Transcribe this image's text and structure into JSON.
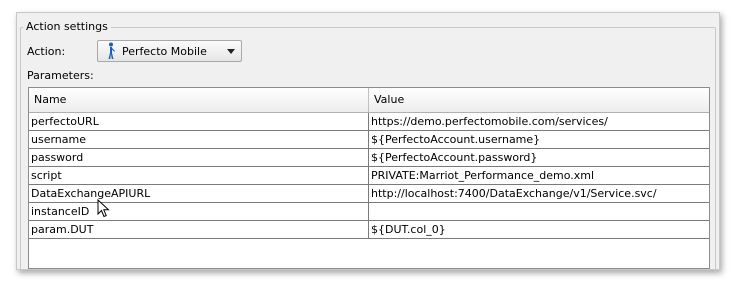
{
  "group_title": "Action settings",
  "action": {
    "label": "Action:",
    "selected": "Perfecto Mobile"
  },
  "parameters_label": "Parameters:",
  "table": {
    "columns": [
      "Name",
      "Value"
    ],
    "rows": [
      {
        "name": "perfectoURL",
        "value": "https://demo.perfectomobile.com/services/"
      },
      {
        "name": "username",
        "value": "${PerfectoAccount.username}"
      },
      {
        "name": "password",
        "value": "${PerfectoAccount.password}"
      },
      {
        "name": "script",
        "value": "PRIVATE:Marriot_Performance_demo.xml"
      },
      {
        "name": "DataExchangeAPIURL",
        "value": "http://localhost:7400/DataExchange/v1/Service.svc/"
      },
      {
        "name": "instanceID",
        "value": ""
      },
      {
        "name": "param.DUT",
        "value": "${DUT.col_0}"
      }
    ]
  },
  "icons": {
    "dropdown": "person-icon",
    "caret": "chevron-down-icon",
    "pointer": "mouse-cursor-icon"
  },
  "colors": {
    "icon_blue": "#1a5fb4",
    "border": "#8c8c8c"
  }
}
